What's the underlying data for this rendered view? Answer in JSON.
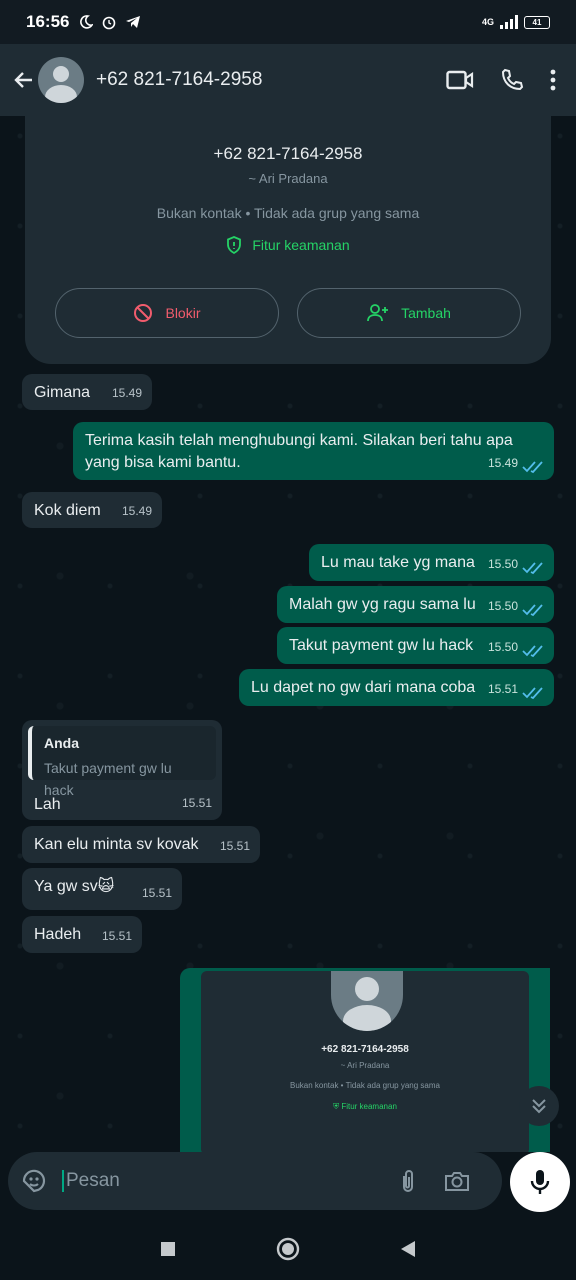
{
  "status": {
    "time": "16:56",
    "network": "4G",
    "battery": "41"
  },
  "header": {
    "title": "+62 821-7164-2958"
  },
  "contact_card": {
    "number": "+62 821-7164-2958",
    "alias": "~ Ari Pradana",
    "info": "Bukan kontak • Tidak ada grup yang sama",
    "security": "Fitur keamanan",
    "block_label": "Blokir",
    "add_label": "Tambah"
  },
  "messages": [
    {
      "dir": "in",
      "text": "Gimana",
      "time": "15.49"
    },
    {
      "dir": "out",
      "text": "Terima kasih telah menghubungi kami. Silakan beri tahu apa yang bisa kami bantu.",
      "time": "15.49"
    },
    {
      "dir": "in",
      "text": "Kok diem",
      "time": "15.49"
    },
    {
      "dir": "out",
      "text": "Lu mau take yg mana",
      "time": "15.50"
    },
    {
      "dir": "out",
      "text": "Malah gw yg ragu sama lu",
      "time": "15.50"
    },
    {
      "dir": "out",
      "text": "Takut payment gw lu hack",
      "time": "15.50"
    },
    {
      "dir": "out",
      "text": "Lu dapet no gw dari mana coba",
      "time": "15.51"
    },
    {
      "dir": "in",
      "quote_name": "Anda",
      "quote_text": "Takut payment gw lu hack",
      "text": "Lah",
      "time": "15.51"
    },
    {
      "dir": "in",
      "text": "Kan elu minta sv kovak",
      "time": "15.51"
    },
    {
      "dir": "in",
      "text": "Ya gw sv🙀",
      "time": "15.51"
    },
    {
      "dir": "in",
      "text": "Hadeh",
      "time": "15.51"
    }
  ],
  "image_preview": {
    "number": "+62 821-7164-2958",
    "alias": "~ Ari Pradana",
    "info": "Bukan kontak • Tidak ada grup yang sama",
    "security": "Fitur keamanan"
  },
  "composer": {
    "placeholder": "Pesan"
  },
  "colors": {
    "accent": "#25d366",
    "outgoing": "#005c4b",
    "incoming": "#1f2c34",
    "danger": "#f15c6d",
    "read_ticks": "#53bdeb"
  }
}
